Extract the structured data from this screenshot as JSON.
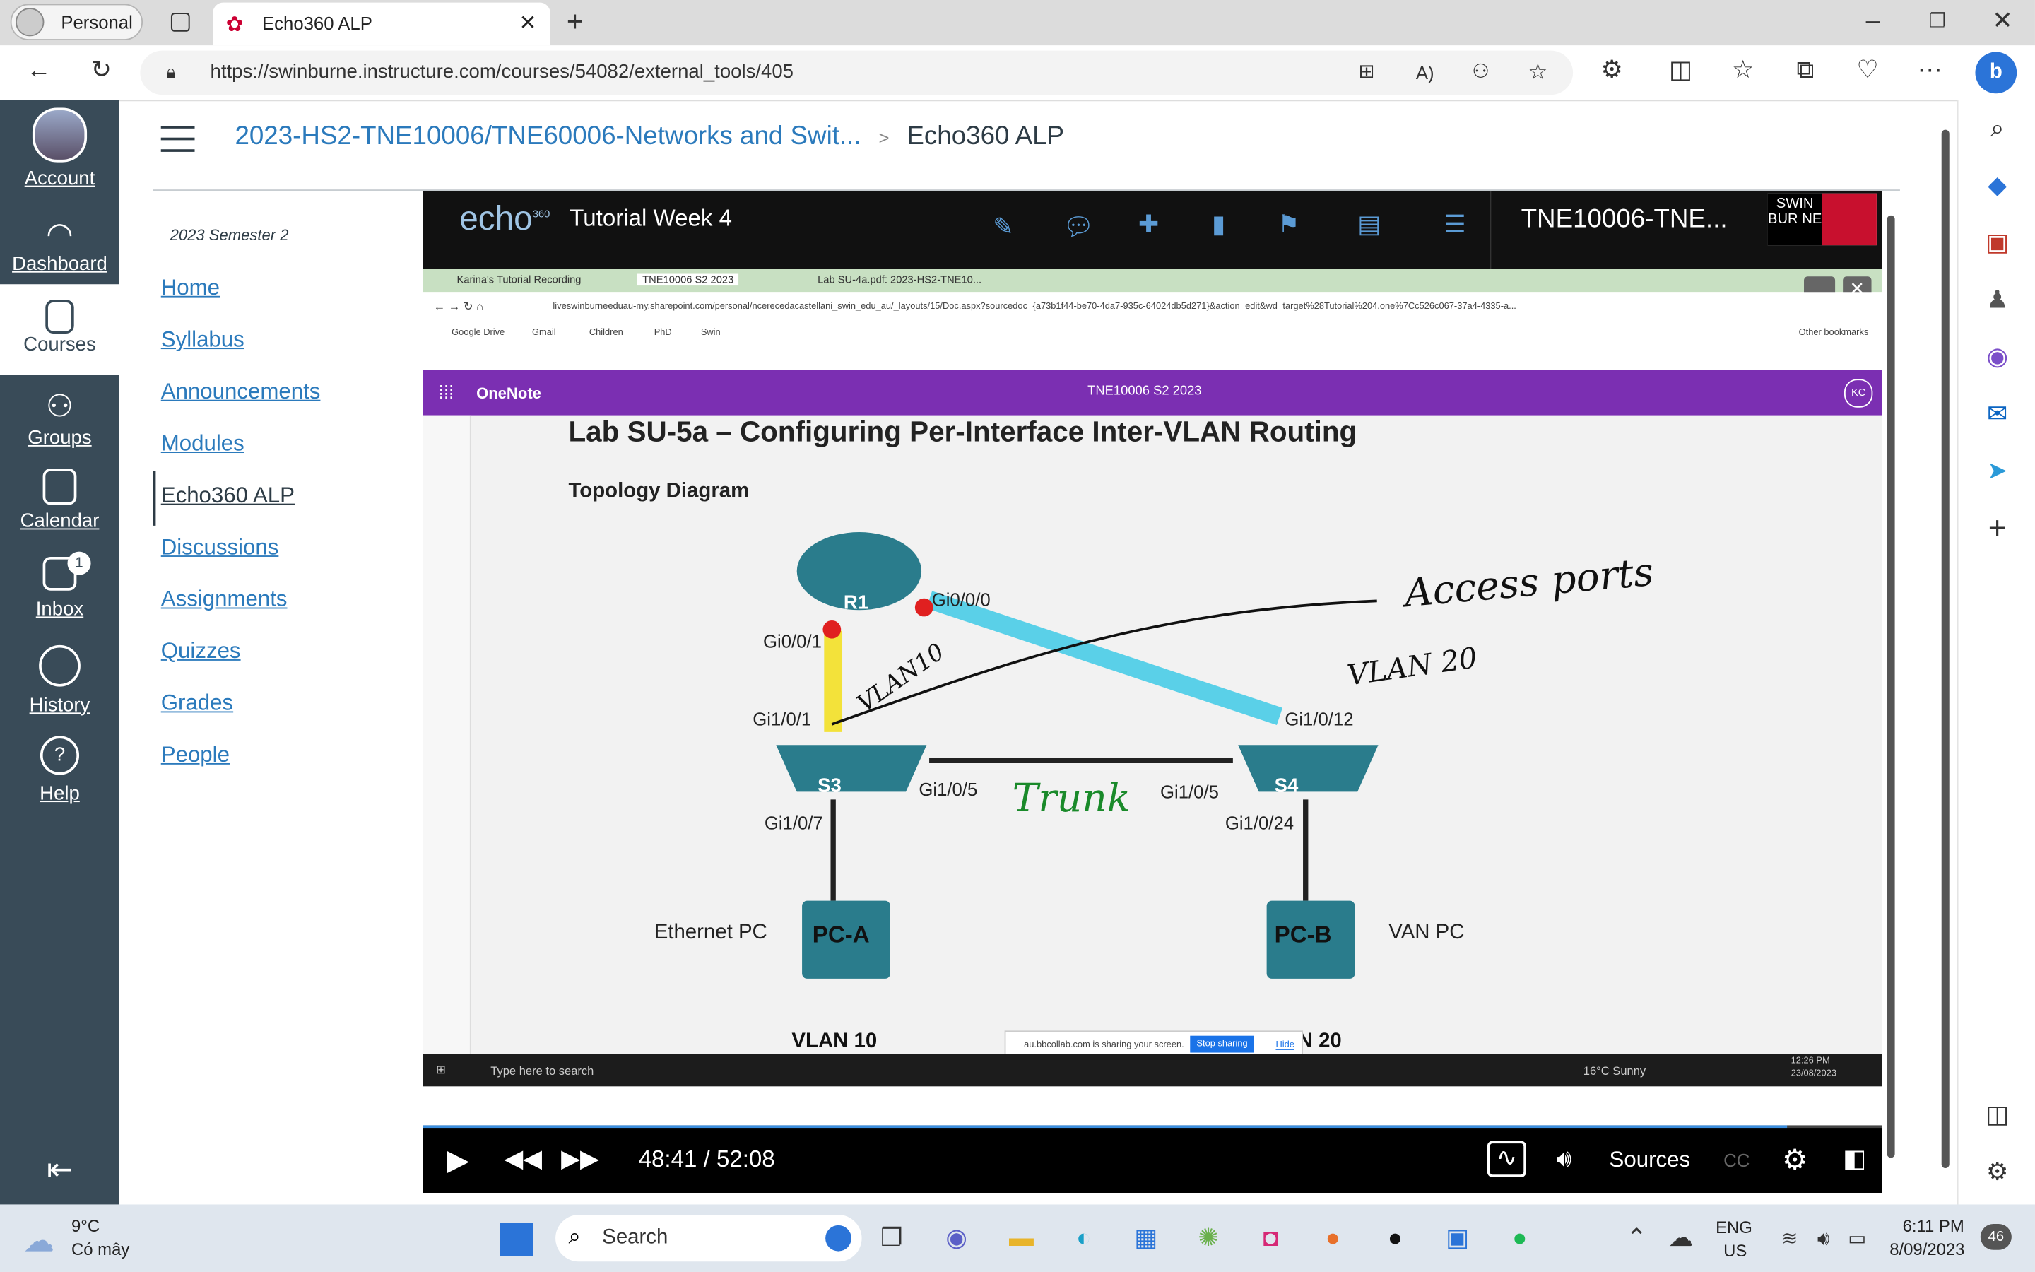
{
  "browser": {
    "profile": "Personal",
    "tab_title": "Echo360 ALP",
    "url": "https://swinburne.instructure.com/courses/54082/external_tools/405"
  },
  "global_nav": {
    "items": [
      {
        "label": "Account"
      },
      {
        "label": "Dashboard"
      },
      {
        "label": "Courses"
      },
      {
        "label": "Groups"
      },
      {
        "label": "Calendar"
      },
      {
        "label": "Inbox",
        "badge": "1"
      },
      {
        "label": "History"
      },
      {
        "label": "Help"
      }
    ]
  },
  "breadcrumb": {
    "course": "2023-HS2-TNE10006/TNE60006-Networks and Swit...",
    "separator": ">",
    "current": "Echo360 ALP"
  },
  "course_nav": {
    "term": "2023 Semester 2",
    "items": [
      "Home",
      "Syllabus",
      "Announcements",
      "Modules",
      "Echo360 ALP",
      "Discussions",
      "Assignments",
      "Quizzes",
      "Grades",
      "People"
    ]
  },
  "player": {
    "logo": "echo",
    "logo_sup": "360",
    "title": "Tutorial Week 4",
    "course_code": "TNE10006-TNE...",
    "uni_logo": "SWIN BUR NE",
    "time": "48:41 / 52:08",
    "progress": 0.935,
    "sources_label": "Sources",
    "cc_label": "CC"
  },
  "shared_screen": {
    "tabs": [
      "Karina's Tutorial Recording",
      "TNE10006 S2 2023",
      "Lab SU-4a.pdf: 2023-HS2-TNE10..."
    ],
    "inner_url": "liveswinburneeduau-my.sharepoint.com/personal/ncerecedacastellani_swin_edu_au/_layouts/15/Doc.aspx?sourcedoc={a73b1f44-be70-4da7-935c-64024db5d271}&action=edit&wd=target%28Tutorial%204.one%7Cc526c067-37a4-4335-a...",
    "bookmarks": [
      "Google Drive",
      "Gmail",
      "Children",
      "PhD",
      "Swin"
    ],
    "other_bookmarks": "Other bookmarks",
    "app_name": "OneNote",
    "notebook": "TNE10006 S2 2023",
    "avatar": "KC",
    "lab_title": "Lab SU-5a – Configuring Per-Interface Inter-VLAN Routing",
    "topology_heading": "Topology Diagram",
    "labels": {
      "r1": "R1",
      "s3": "S3",
      "s4": "S4",
      "pca": "PC-A",
      "pcb": "PC-B",
      "gi000": "Gi0/0/0",
      "gi001": "Gi0/0/1",
      "gi101": "Gi1/0/1",
      "gi1012": "Gi1/0/12",
      "gi105a": "Gi1/0/5",
      "gi105b": "Gi1/0/5",
      "gi107": "Gi1/0/7",
      "gi1024": "Gi1/0/24",
      "ethpc": "Ethernet PC",
      "vanpc": "VAN PC",
      "vlan10": "VLAN 10",
      "vlan20": "N 20"
    },
    "annotations": {
      "access": "Access ports",
      "vlan10h": "VLAN10",
      "vlan20h": "VLAN 20",
      "trunk": "Trunk"
    },
    "sharing_text": "au.bbcollab.com is sharing your screen.",
    "stop_sharing": "Stop sharing",
    "hide": "Hide",
    "search_placeholder": "Type here to search",
    "weather": "16°C  Sunny",
    "clock_time": "12:26 PM",
    "clock_date": "23/08/2023"
  },
  "taskbar": {
    "temp": "9°C",
    "condition": "Có mây",
    "search": "Search",
    "lang": "ENG",
    "region": "US",
    "time": "6:11 PM",
    "date": "8/09/2023",
    "notif": "46"
  },
  "colors": {
    "canvas_nav": "#394b58",
    "link": "#2b7abc",
    "onenote": "#7b2fb2",
    "trunk": "#1a8a2a"
  }
}
